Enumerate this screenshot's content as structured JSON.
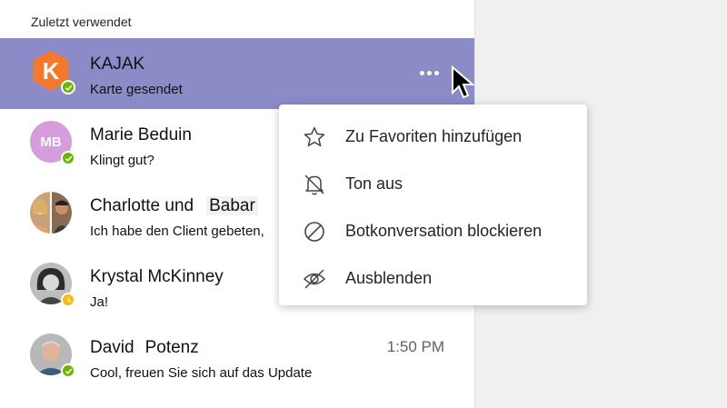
{
  "section_title": "Zuletzt verwendet",
  "chats": [
    {
      "first": "KAJAK",
      "second": "",
      "preview": "Karte gesendet",
      "time": "",
      "initials": "K",
      "status": "available"
    },
    {
      "first": "Marie Beduin",
      "second": "",
      "preview": "Klingt gut?",
      "time": "",
      "initials": "MB",
      "status": "available"
    },
    {
      "first": "Charlotte und",
      "second": "Babar",
      "preview": "Ich habe den Client gebeten,",
      "time": "",
      "status": "none"
    },
    {
      "first": "Krystal McKinney",
      "second": "",
      "preview": "Ja!",
      "time": "",
      "status": "away"
    },
    {
      "first": "David",
      "second": "Potenz",
      "preview": "Cool, freuen Sie sich auf das Update",
      "time": "1:50 PM",
      "status": "available"
    }
  ],
  "context_menu": [
    {
      "label": "Zu Favoriten hinzufügen",
      "icon": "star-icon"
    },
    {
      "label": "Ton aus",
      "icon": "bell-muted-icon"
    },
    {
      "label": "Botkonversation blockieren",
      "icon": "block-icon"
    },
    {
      "label": "Ausblenden",
      "icon": "eye-hidden-icon"
    }
  ],
  "colors": {
    "selected_row": "#8b8cc7",
    "kajak_orange": "#f4792b",
    "mb_avatar": "#d59ddb",
    "available": "#6bb700",
    "away": "#fdb913"
  }
}
